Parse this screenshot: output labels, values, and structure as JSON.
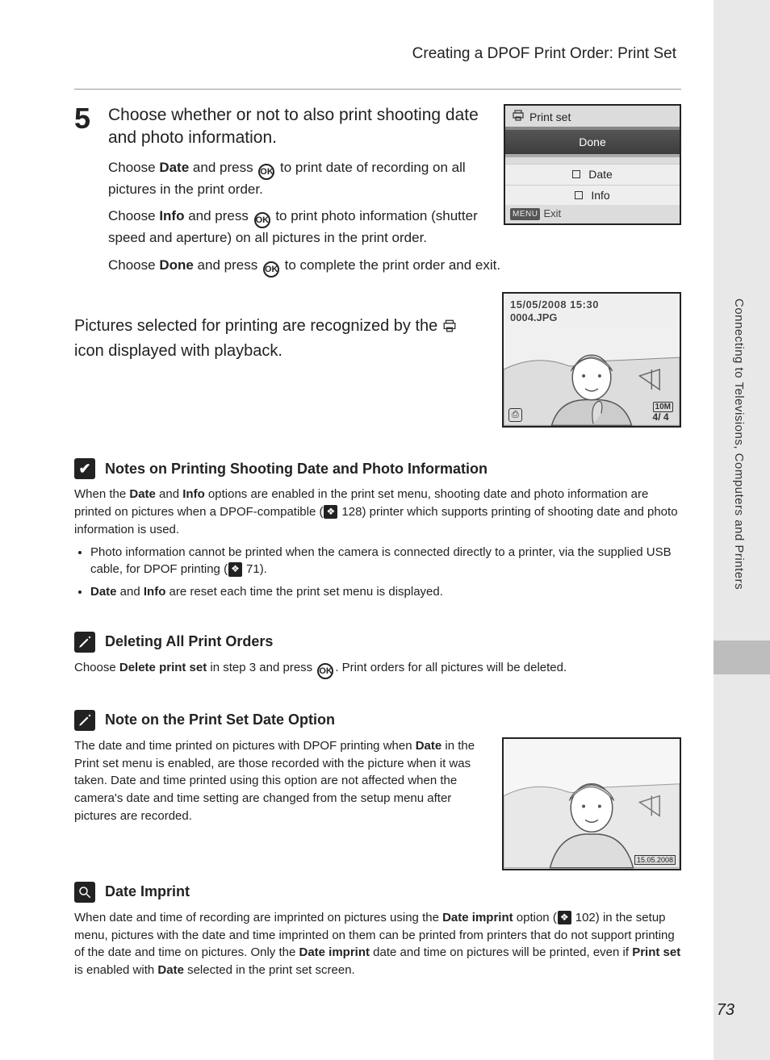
{
  "header": {
    "title": "Creating a DPOF Print Order: Print Set"
  },
  "sidebar": {
    "label": "Connecting to Televisions, Computers and Printers"
  },
  "step": {
    "number": "5",
    "heading": "Choose whether or not to also print shooting date and photo information.",
    "p1a": "Choose ",
    "p1b": "Date",
    "p1c": " and press ",
    "p1d": " to print date of recording on all pictures in the print order.",
    "p2a": "Choose ",
    "p2b": "Info",
    "p2c": " and press ",
    "p2d": " to print photo information (shutter speed and aperture) on all pictures in the print order.",
    "p3a": "Choose ",
    "p3b": "Done",
    "p3c": " and press ",
    "p3d": " to complete the print order and exit."
  },
  "ok_label": "OK",
  "lcd": {
    "title": "Print set",
    "done": "Done",
    "date": "Date",
    "info": "Info",
    "menu_btn": "MENU",
    "exit": "Exit"
  },
  "playback": {
    "pre": "Pictures selected for printing are recognized by the ",
    "post": " icon displayed with playback.",
    "thumb_date": "15/05/2008 15:30",
    "thumb_file": "0004.JPG",
    "thumb_counter": "4/    4",
    "thumb_res": "10M",
    "thumb_bl": "⎙"
  },
  "notes1": {
    "title": "Notes on Printing Shooting Date and Photo Information",
    "p1a": "When the ",
    "p1b": "Date",
    "p1c": " and ",
    "p1d": "Info",
    "p1e": " options are enabled in the print set menu, shooting date and photo information are printed on pictures when a DPOF-compatible (",
    "ref1": "128",
    "p1f": ") printer which supports printing of shooting date and photo information is used.",
    "b1a": "Photo information cannot be printed when the camera is connected directly to a printer, via the supplied USB cable, for DPOF printing (",
    "b1ref": "71",
    "b1b": ").",
    "b2a": "Date",
    "b2b": " and ",
    "b2c": "Info",
    "b2d": " are reset each time the print set menu is displayed."
  },
  "notes2": {
    "title": "Deleting All Print Orders",
    "p1a": "Choose ",
    "p1b": "Delete print set",
    "p1c": " in step 3 and press ",
    "p1d": ". Print orders for all pictures will be deleted."
  },
  "notes3": {
    "title": "Note on the Print Set Date Option",
    "p1a": "The date and time printed on pictures with DPOF printing when ",
    "p1b": "Date",
    "p1c": " in the Print set menu is enabled, are those recorded with the picture when it was taken. Date and time printed using this option are not affected when the camera's date and time setting are changed from the setup menu after pictures are recorded."
  },
  "notes4": {
    "title": "Date Imprint",
    "p1a": "When date and time of recording are imprinted on pictures using the ",
    "p1b": "Date imprint",
    "p1c": " option (",
    "ref": "102",
    "p1d": ") in the setup menu, pictures with the date and time imprinted on them can be printed from printers that do not support printing of the date and time on pictures. Only the ",
    "p1e": "Date imprint",
    "p1f": " date and time on pictures will be printed, even if ",
    "p1g": "Print set",
    "p1h": " is enabled with ",
    "p1i": "Date",
    "p1j": " selected in the print set screen.",
    "imprint_date": "15.05.2008"
  },
  "page_number": "73"
}
